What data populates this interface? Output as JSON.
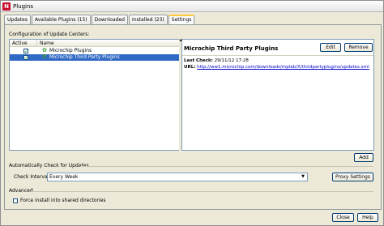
{
  "window": {
    "title": "Plugins",
    "app_icon_glyph": "N"
  },
  "tabs": [
    {
      "label": "Updates",
      "active": false
    },
    {
      "label": "Available Plugins (15)",
      "active": false
    },
    {
      "label": "Downloaded",
      "active": false
    },
    {
      "label": "Installed (23)",
      "active": false
    },
    {
      "label": "Settings",
      "active": true
    }
  ],
  "settings": {
    "config_label": "Configuration of Update Centers:",
    "columns": {
      "active": "Active",
      "name": "Name"
    },
    "update_centers": [
      {
        "name": "Microchip Plugins",
        "active": true,
        "selected": false
      },
      {
        "name": "Microchip Third Party Plugins",
        "active": true,
        "selected": true
      }
    ],
    "details": {
      "title": "Microchip Third Party Plugins",
      "edit_label": "Edit",
      "remove_label": "Remove",
      "last_check_label": "Last Check:",
      "last_check_value": "29/11/12 17:28",
      "url_label": "URL:",
      "url_value": "http://ww1.microchip.com/downloads/mplab/X/thirdpartyplugins/updates.xml"
    },
    "add_label": "Add",
    "auto_check": {
      "section_label": "Automatically Check for Updates",
      "interval_label": "Check Interval:",
      "interval_value": "Every Week",
      "proxy_label": "Proxy Settings"
    },
    "advanced": {
      "section_label": "Advanced",
      "force_install_label": "Force install into shared directories",
      "force_install_checked": false
    }
  },
  "footer": {
    "close_label": "Close",
    "help_label": "Help"
  },
  "colors": {
    "selection": "#316ac5",
    "link": "#0000cc",
    "tab_highlight": "#ffc83c",
    "brand": "#c8102e"
  },
  "icons": {
    "check": "✓",
    "puzzle": "✿",
    "dropdown": "▼",
    "split": "◀"
  }
}
